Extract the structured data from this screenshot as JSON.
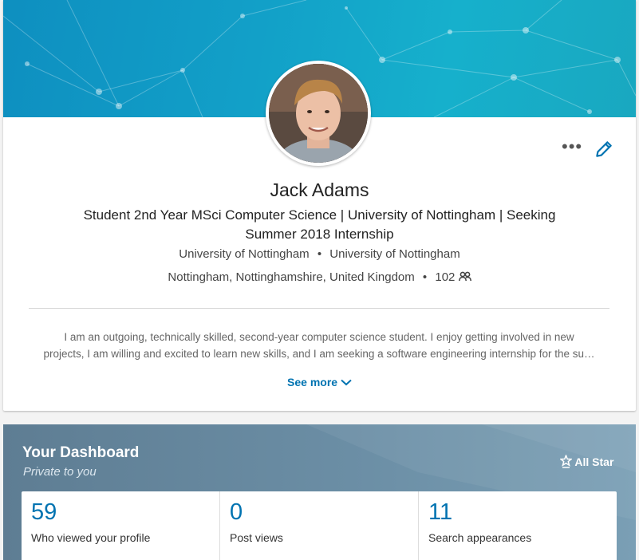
{
  "profile": {
    "name": "Jack Adams",
    "headline": "Student 2nd Year MSci Computer Science | University of Nottingham | Seeking Summer 2018 Internship",
    "school": "University of Nottingham",
    "education": "University of Nottingham",
    "location": "Nottingham, Nottinghamshire, United Kingdom",
    "connections": "102",
    "summary_line1": "I am an outgoing, technically skilled, second-year computer science student. I enjoy getting involved in new",
    "summary_line2": "projects, I am willing and excited to learn new skills, and I am seeking a software engineering internship for the su…",
    "see_more": "See more",
    "bullet": "•"
  },
  "actions": {
    "more_icon": "more-horizontal-icon",
    "edit_icon": "pencil-icon"
  },
  "dashboard": {
    "title": "Your Dashboard",
    "subtitle": "Private to you",
    "all_star": "All Star",
    "stats": [
      {
        "value": "59",
        "label": "Who viewed your profile"
      },
      {
        "value": "0",
        "label": "Post views"
      },
      {
        "value": "11",
        "label": "Search appearances"
      }
    ]
  },
  "colors": {
    "accent": "#0073b1",
    "banner": "#12a0c8",
    "dashboard": "#6b8ea5"
  }
}
